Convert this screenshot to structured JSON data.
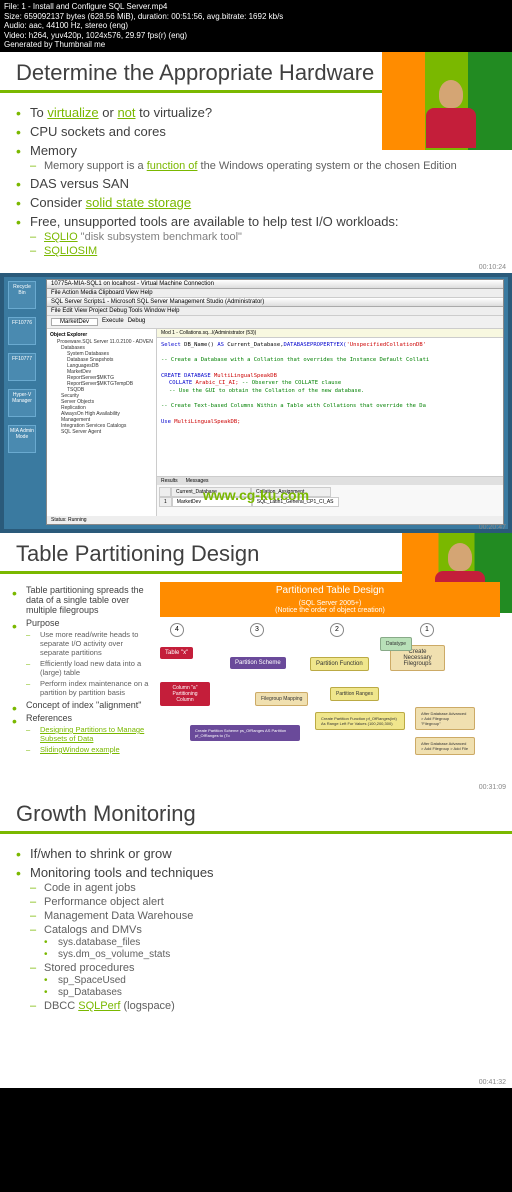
{
  "header": {
    "line1": "File: 1 - Install and Configure SQL Server.mp4",
    "line2": "Size: 659092137 bytes (628.56 MiB), duration: 00:51:56, avg.bitrate: 1692 kb/s",
    "line3": "Audio: aac, 44100 Hz, stereo (eng)",
    "line4": "Video: h264, yuv420p, 1024x576, 29.97 fps(r) (eng)",
    "line5": "Generated by Thumbnail me"
  },
  "slide1": {
    "title": "Determine the Appropriate Hardware",
    "b1_pre": "To ",
    "b1_link1": "virtualize",
    "b1_mid": " or ",
    "b1_link2": "not",
    "b1_post": " to virtualize?",
    "b2": "CPU sockets and cores",
    "b3": "Memory",
    "b3s1_pre": "Memory support is a ",
    "b3s1_link": "function of",
    "b3s1_post": " the Windows operating system or the chosen Edition",
    "b4": "DAS versus SAN",
    "b5_pre": "Consider ",
    "b5_link": "solid state storage",
    "b6": "Free, unsupported tools are available to help test I/O workloads:",
    "b6s1_link": "SQLIO",
    "b6s1_quote": " \"disk subsystem benchmark tool\"",
    "b6s2_link": "SQLIOSIM",
    "timestamp": "00:10:24"
  },
  "screenshot": {
    "vm_title": "10775A-MIA-SQL1 on localhost - Virtual Machine Connection",
    "vm_menu": "File   Action   Media   Clipboard   View   Help",
    "ssms_title": "SQL Server Scripts1 - Microsoft SQL Server Management Studio (Administrator)",
    "ssms_menu": "File   Edit   View   Project   Debug   Tools   Window   Help",
    "toolbar_dropdown": "MarketDev",
    "toolbar_exec": "Execute",
    "toolbar_debug": "Debug",
    "tree_title": "Object Explorer",
    "tree_root": "Proseware.SQL Server 11.0.2100 - ADVEN",
    "tree_items": [
      "Databases",
      "System Databases",
      "Database Snapshots",
      "LanguagesDB",
      "MarketDev",
      "ReportServer$MKTG",
      "ReportServer$MKTGTempDB",
      "TSQDB",
      "Security",
      "Server Objects",
      "Replication",
      "AlwaysOn High Availability",
      "Management",
      "Integration Services Catalogs",
      "SQL Server Agent"
    ],
    "tab_name": "Mod 1 - Collations.sq...l(Administrator (53))",
    "sql_line1_a": "Select",
    "sql_line1_b": " DB_Name() ",
    "sql_line1_c": "AS",
    "sql_line1_d": " Current_Database,",
    "sql_line1_e": "DATABASEPROPERTYEX(",
    "sql_line1_f": "'UnspecifiedCollationDB'",
    "sql_comment1": "-- Create a Database with a Collation that overrides the Instance Default Collati",
    "sql_line2_a": "CREATE DATABASE",
    "sql_line2_b": " MultiLingualSpeakDB",
    "sql_line3_a": "COLLATE",
    "sql_line3_b": " Arabic_CI_AI;",
    "sql_comment2": " -- Observer the COLLATE clause",
    "sql_comment3": "-- Use the GUI to obtain the Collation of the new database.",
    "sql_comment4": "-- Create Text-based Columns Within a Table with Collations that override the Da",
    "sql_line4_a": "Use",
    "sql_line4_b": " MultiLingualSpeakDB;",
    "results_tab1": "Results",
    "results_tab2": "Messages",
    "col1": "Current_Database",
    "col2": "Collation_Assignment",
    "val1": "MarketDev",
    "val2": "SQL_Latin1_General_CP1_CI_AS",
    "status": "Status: Running",
    "watermark": "www.cg-ku.com",
    "timestamp": "00:20:47",
    "icons": [
      "Recycle Bin",
      "FF10776",
      "FF10777",
      "Hyper-V Manager",
      "MIA Admin Mode"
    ]
  },
  "slide2": {
    "title": "Table Partitioning Design",
    "b1": "Table partitioning spreads the data of a single table over multiple filegroups",
    "b2": "Purpose",
    "b2s1": "Use more read/write heads to separate I/O activity over separate partitions",
    "b2s2": "Efficiently load new data into a (large) table",
    "b2s3": "Perform index maintenance on a partition by partition basis",
    "b3": "Concept of index \"alignment\"",
    "b4": "References",
    "b4s1": "Designing Partitions to Manage Subsets of Data",
    "b4s2": "SlidingWindow example",
    "diagram_title": "Partitioned Table Design",
    "diagram_sub1": "(SQL Server 2005+)",
    "diagram_sub2": "(Notice the order of object creation)",
    "step1": "1",
    "step2": "2",
    "step3": "3",
    "step4": "4",
    "box_table": "Table \"x\"",
    "box_scheme": "Partition Scheme",
    "box_function": "Partition Function",
    "box_filegroups": "Create Necessary Filegroups",
    "box_datatype": "Datatype",
    "box_ranges": "Partition Ranges",
    "box_mapping": "Filegroup Mapping",
    "box_column": "Column \"a\" Partitioning Column",
    "code1": "Create Partition Scheme ps_OfRanges AS Partition pf_OfRanges to (To",
    "code2": "Create Partition Function pf_OfRanges(int) As Range Left For Values (100,200,300)",
    "note1": "After Database Advanced > Add Filegroup \"Filegroup\"",
    "note2": "After Database Advanced > Add Filegroup > Add File",
    "timestamp": "00:31:09"
  },
  "slide3": {
    "title": "Growth Monitoring",
    "b1": "If/when to shrink or grow",
    "b2": "Monitoring tools and techniques",
    "b2s1": "Code in agent jobs",
    "b2s2": "Performance object alert",
    "b2s3": "Management Data Warehouse",
    "b2s4": "Catalogs and DMVs",
    "b2s4s1": "sys.database_files",
    "b2s4s2": "sys.dm_os_volume_stats",
    "b2s5": "Stored procedures",
    "b2s5s1": "sp_SpaceUsed",
    "b2s5s2": "sp_Databases",
    "b2s6_pre": "DBCC ",
    "b2s6_link": "SQLPerf",
    "b2s6_post": " (logspace)",
    "timestamp": "00:41:32"
  }
}
